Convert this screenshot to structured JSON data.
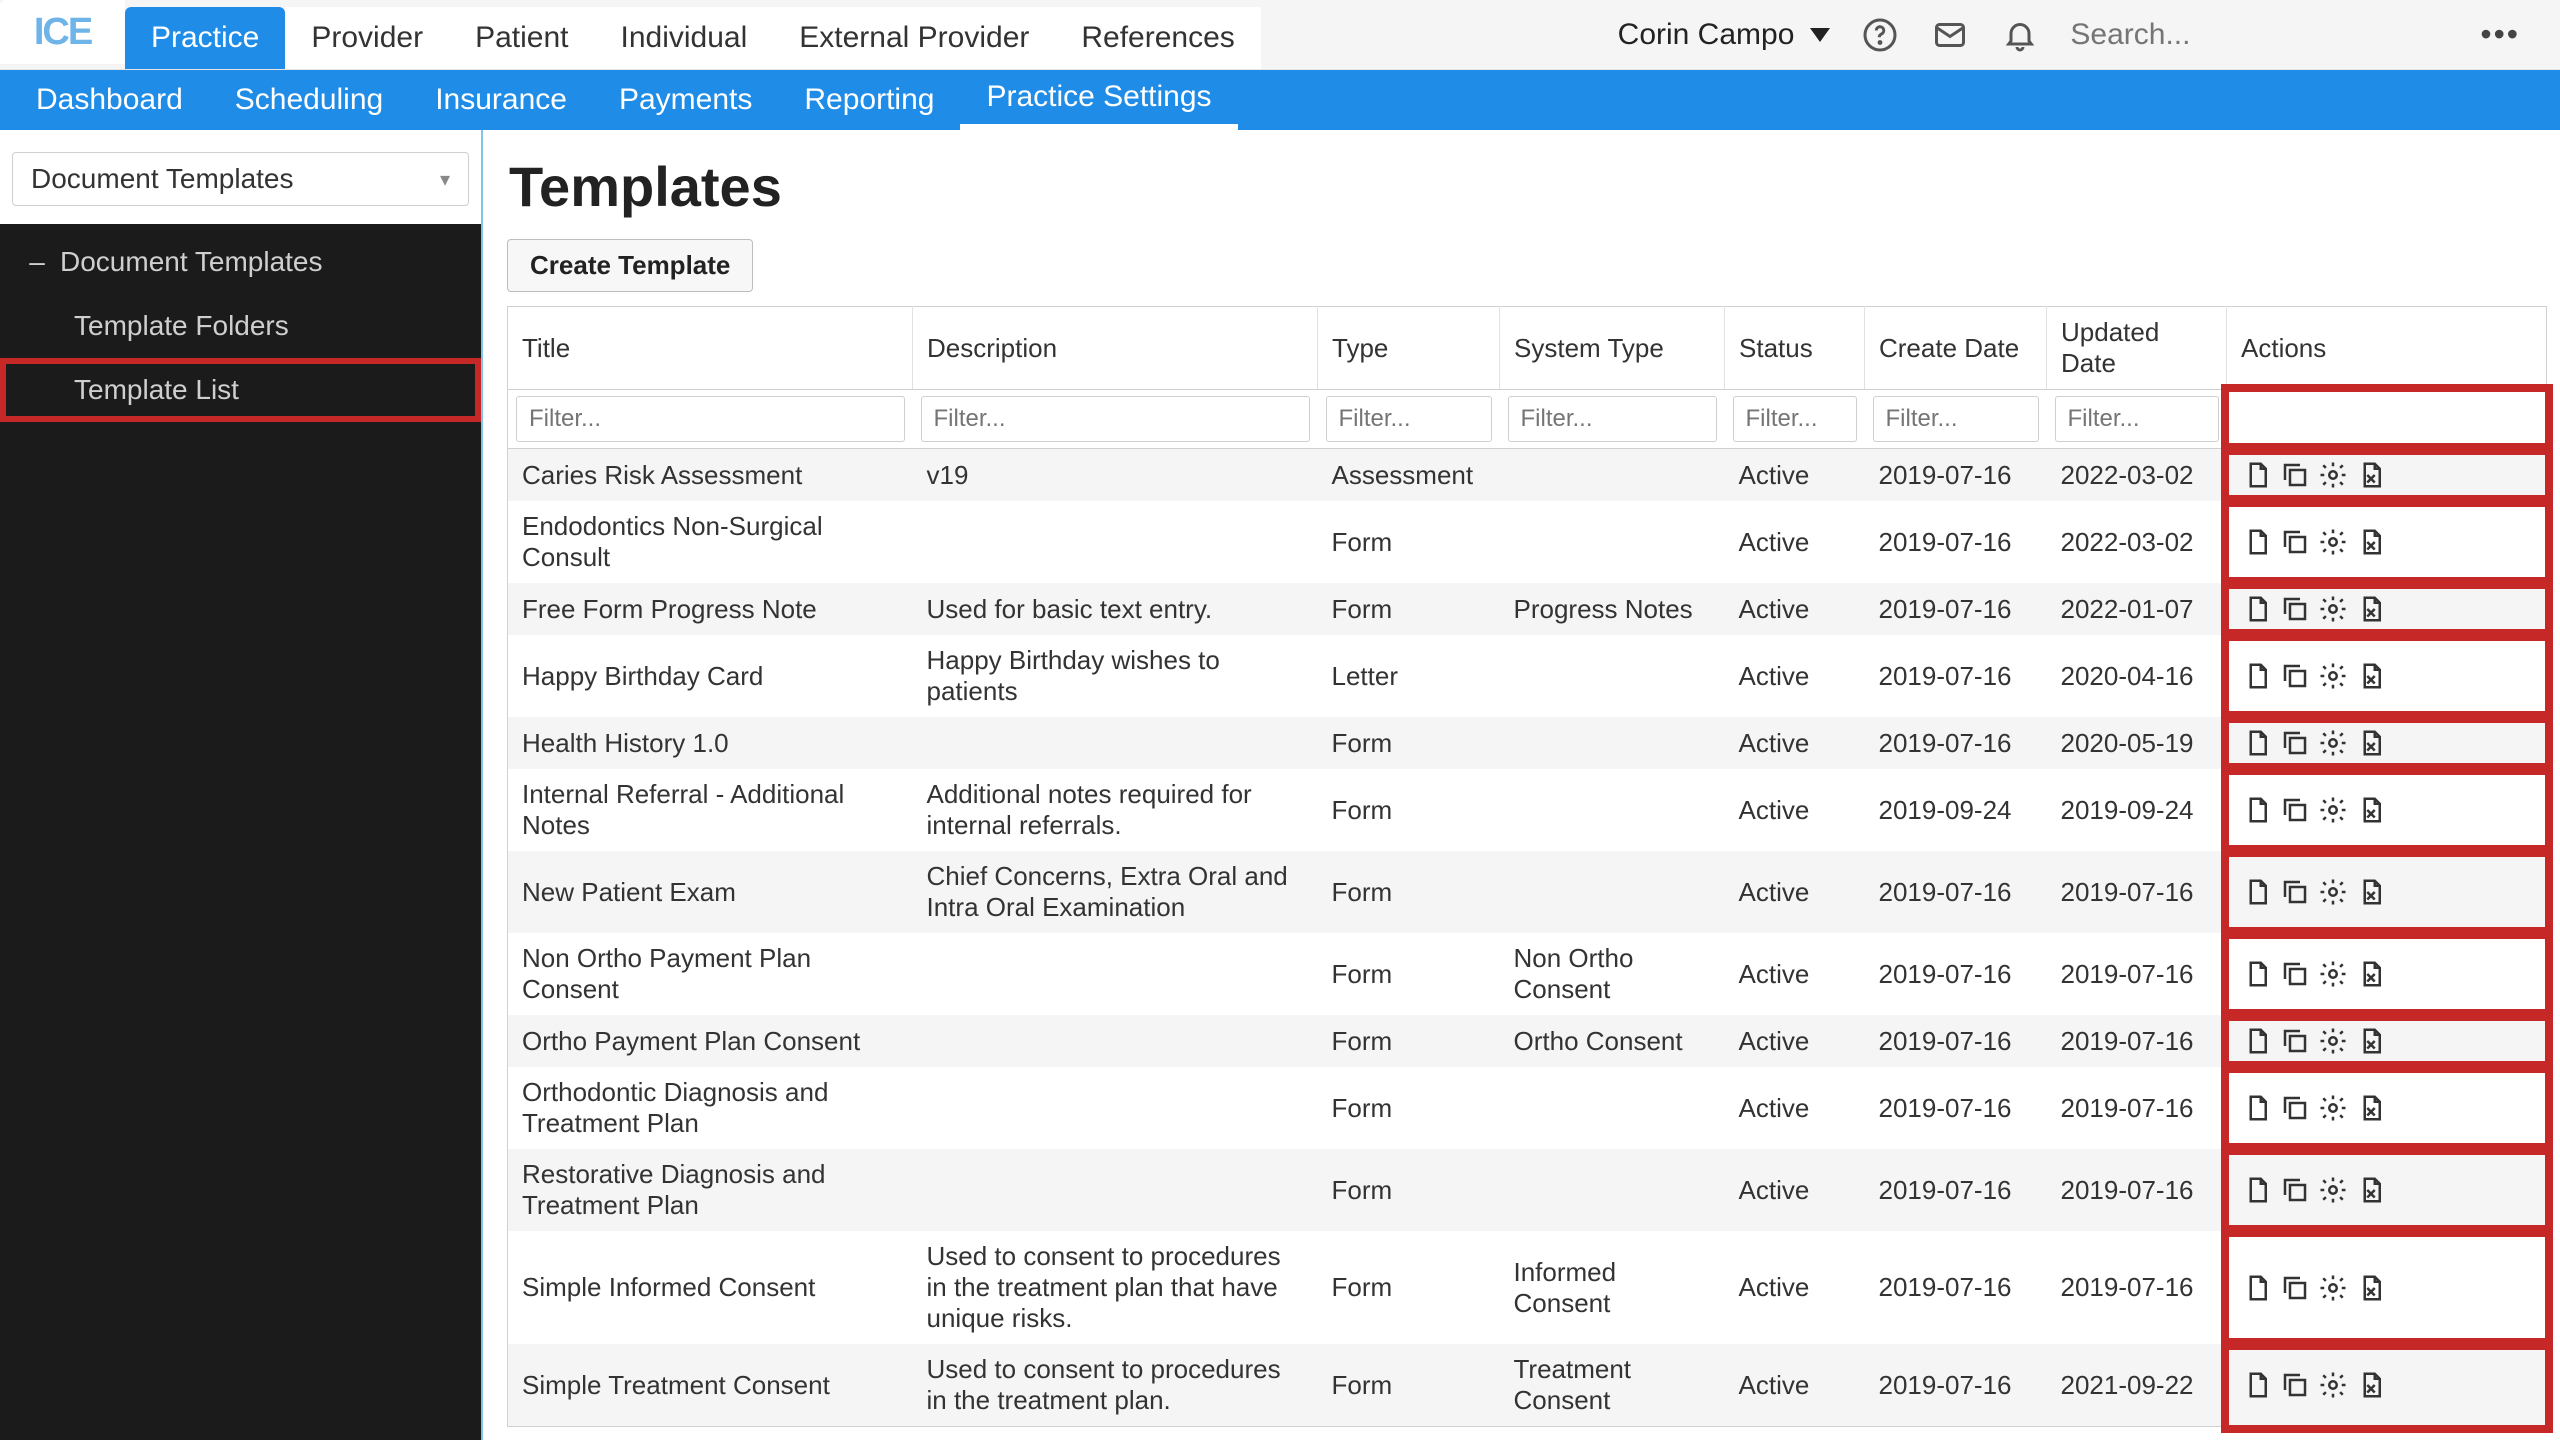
{
  "header": {
    "logo_text": "ICE",
    "tabs": [
      "Practice",
      "Provider",
      "Patient",
      "Individual",
      "External Provider",
      "References"
    ],
    "active_tab_index": 0,
    "user_name": "Corin Campo",
    "search_placeholder": "Search..."
  },
  "subnav": {
    "tabs": [
      "Dashboard",
      "Scheduling",
      "Insurance",
      "Payments",
      "Reporting",
      "Practice Settings"
    ],
    "active_index": 5
  },
  "sidebar": {
    "select_label": "Document Templates",
    "tree": {
      "root_label": "Document Templates",
      "children": [
        "Template Folders",
        "Template List"
      ],
      "selected_index": 1
    }
  },
  "page": {
    "title": "Templates",
    "create_button": "Create Template"
  },
  "table": {
    "columns": {
      "title": "Title",
      "description": "Description",
      "type": "Type",
      "system_type": "System Type",
      "status": "Status",
      "create_date": "Create Date",
      "updated_date": "Updated Date",
      "actions": "Actions"
    },
    "filter_placeholder": "Filter...",
    "rows": [
      {
        "title": "Caries Risk Assessment",
        "description": "v19",
        "type": "Assessment",
        "system_type": "",
        "status": "Active",
        "create_date": "2019-07-16",
        "updated_date": "2022-03-02"
      },
      {
        "title": "Endodontics Non-Surgical Consult",
        "description": "",
        "type": "Form",
        "system_type": "",
        "status": "Active",
        "create_date": "2019-07-16",
        "updated_date": "2022-03-02"
      },
      {
        "title": "Free Form Progress Note",
        "description": "Used for basic text entry.",
        "type": "Form",
        "system_type": "Progress Notes",
        "status": "Active",
        "create_date": "2019-07-16",
        "updated_date": "2022-01-07"
      },
      {
        "title": "Happy Birthday Card",
        "description": "Happy Birthday wishes to patients",
        "type": "Letter",
        "system_type": "",
        "status": "Active",
        "create_date": "2019-07-16",
        "updated_date": "2020-04-16"
      },
      {
        "title": "Health History 1.0",
        "description": "",
        "type": "Form",
        "system_type": "",
        "status": "Active",
        "create_date": "2019-07-16",
        "updated_date": "2020-05-19"
      },
      {
        "title": "Internal Referral - Additional Notes",
        "description": "Additional notes required for internal referrals.",
        "type": "Form",
        "system_type": "",
        "status": "Active",
        "create_date": "2019-09-24",
        "updated_date": "2019-09-24"
      },
      {
        "title": "New Patient Exam",
        "description": "Chief Concerns, Extra Oral and Intra Oral Examination",
        "type": "Form",
        "system_type": "",
        "status": "Active",
        "create_date": "2019-07-16",
        "updated_date": "2019-07-16"
      },
      {
        "title": "Non Ortho Payment Plan Consent",
        "description": "",
        "type": "Form",
        "system_type": "Non Ortho Consent",
        "status": "Active",
        "create_date": "2019-07-16",
        "updated_date": "2019-07-16"
      },
      {
        "title": "Ortho Payment Plan Consent",
        "description": "",
        "type": "Form",
        "system_type": "Ortho Consent",
        "status": "Active",
        "create_date": "2019-07-16",
        "updated_date": "2019-07-16"
      },
      {
        "title": "Orthodontic Diagnosis and Treatment Plan",
        "description": "",
        "type": "Form",
        "system_type": "",
        "status": "Active",
        "create_date": "2019-07-16",
        "updated_date": "2019-07-16"
      },
      {
        "title": "Restorative Diagnosis and Treatment Plan",
        "description": "",
        "type": "Form",
        "system_type": "",
        "status": "Active",
        "create_date": "2019-07-16",
        "updated_date": "2019-07-16"
      },
      {
        "title": "Simple Informed Consent",
        "description": "Used to consent to procedures in the treatment plan that have unique risks.",
        "type": "Form",
        "system_type": "Informed Consent",
        "status": "Active",
        "create_date": "2019-07-16",
        "updated_date": "2019-07-16"
      },
      {
        "title": "Simple Treatment Consent",
        "description": "Used to consent to procedures in the treatment plan.",
        "type": "Form",
        "system_type": "Treatment Consent",
        "status": "Active",
        "create_date": "2019-07-16",
        "updated_date": "2021-09-22"
      }
    ]
  }
}
